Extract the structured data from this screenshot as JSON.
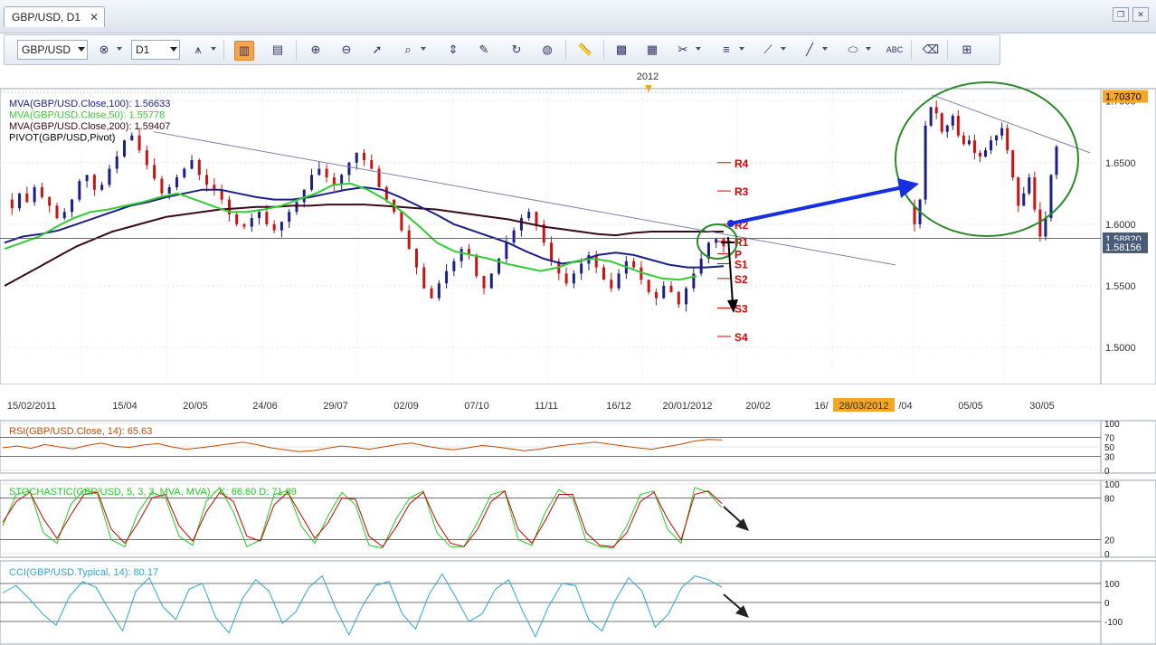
{
  "window": {
    "tab_title": "GBP/USD, D1",
    "close_glyph": "✕",
    "restore_glyph": "❐",
    "close_window_glyph": "✕"
  },
  "toolbar": {
    "symbol": "GBP/USD",
    "timeframe": "D1",
    "icons": [
      "add-remove-instrument-icon",
      "chart-type-icon",
      "bar-chart-icon",
      "candle-chart-icon",
      "period-separator-icon",
      "zoom-in-icon",
      "zoom-out-icon",
      "cursor-icon",
      "zoom-box-icon",
      "fit-icon",
      "export-icon",
      "reload-icon",
      "globe-icon",
      "ruler-icon",
      "picture-icon",
      "image-icon",
      "tools-icon",
      "indicators-icon",
      "drawing-icon",
      "line-icon",
      "ellipse-icon",
      "text-icon",
      "eraser-icon",
      "hierarchy-icon"
    ]
  },
  "chart_data": [
    {
      "type": "candlestick",
      "title": "",
      "top_label": "2012",
      "legend": [
        {
          "text": "MVA(GBP/USD.Close,100): 1.56633",
          "color": "#1b1f8a"
        },
        {
          "text": "MVA(GBP/USD.Close,50): 1.55778",
          "color": "#33cc33"
        },
        {
          "text": "MVA(GBP/USD.Close,200): 1.59407",
          "color": "#3a0a1a"
        },
        {
          "text": "PIVOT(GBP/USD,Pivot)",
          "color": "#000000"
        }
      ],
      "ylim": [
        1.47,
        1.71
      ],
      "y_ticks": [
        "1.7000",
        "1.6500",
        "1.6000",
        "1.5500",
        "1.5000"
      ],
      "price_labels": [
        {
          "value": 1.7037,
          "text": "1.70370",
          "bg": "#f5a623",
          "fg": "#000000"
        },
        {
          "value": 1.5882,
          "text": "1.58820",
          "bg": "#4a5b78",
          "fg": "#ffffff"
        },
        {
          "value": 1.5816,
          "text": "1.58156",
          "bg": "#4a5b78",
          "fg": "#ffffff"
        }
      ],
      "x_labels": [
        "15/02/2011",
        "15/04",
        "20/05",
        "24/06",
        "29/07",
        "02/09",
        "07/10",
        "11/11",
        "16/12",
        "20/01/2012",
        "20/02",
        "16/",
        "28/03/2012",
        "/04",
        "05/05",
        "30/05"
      ],
      "pivot_levels": [
        {
          "name": "R4",
          "value": 1.65,
          "color": "#dd0000"
        },
        {
          "name": "R3",
          "value": 1.627,
          "color": "#dd0000"
        },
        {
          "name": "R2",
          "value": 1.6,
          "color": "#dd0000"
        },
        {
          "name": "R1",
          "value": 1.586,
          "color": "#dd0000"
        },
        {
          "name": "P",
          "value": 1.576,
          "color": "#dd0000"
        },
        {
          "name": "S1",
          "value": 1.568,
          "color": "#dd0000"
        },
        {
          "name": "S2",
          "value": 1.556,
          "color": "#dd0000"
        },
        {
          "name": "S3",
          "value": 1.532,
          "color": "#dd0000"
        },
        {
          "name": "S4",
          "value": 1.509,
          "color": "#dd0000"
        }
      ],
      "price_path": [
        1.62,
        1.613,
        1.625,
        1.618,
        1.63,
        1.622,
        1.615,
        1.605,
        1.61,
        1.62,
        1.635,
        1.64,
        1.628,
        1.632,
        1.645,
        1.655,
        1.668,
        1.672,
        1.66,
        1.648,
        1.637,
        1.625,
        1.63,
        1.638,
        1.645,
        1.652,
        1.64,
        1.632,
        1.628,
        1.62,
        1.608,
        1.6,
        1.598,
        1.605,
        1.61,
        1.6,
        1.595,
        1.602,
        1.61,
        1.618,
        1.628,
        1.64,
        1.645,
        1.638,
        1.632,
        1.64,
        1.65,
        1.658,
        1.652,
        1.645,
        1.63,
        1.62,
        1.61,
        1.595,
        1.58,
        1.565,
        1.548,
        1.54,
        1.552,
        1.562,
        1.57,
        1.58,
        1.575,
        1.558,
        1.548,
        1.56,
        1.572,
        1.585,
        1.595,
        1.605,
        1.61,
        1.6,
        1.585,
        1.57,
        1.56,
        1.552,
        1.56,
        1.568,
        1.575,
        1.565,
        1.555,
        1.548,
        1.56,
        1.57,
        1.565,
        1.555,
        1.545,
        1.54,
        1.55,
        1.545,
        1.535,
        1.548,
        1.56,
        1.572,
        1.585,
        1.588,
        1.582
      ],
      "price_path2": [
        1.615,
        1.6,
        1.62,
        1.68,
        1.695,
        1.69,
        1.675,
        1.68,
        1.688,
        1.672,
        1.665,
        1.668,
        1.658,
        1.655,
        1.66,
        1.668,
        1.672,
        1.678,
        1.66,
        1.638,
        1.615,
        1.625,
        1.638,
        1.612,
        1.59,
        1.605,
        1.64,
        1.663
      ],
      "ma50": [
        1.58,
        1.585,
        1.59,
        1.598,
        1.605,
        1.61,
        1.612,
        1.615,
        1.618,
        1.622,
        1.625,
        1.62,
        1.615,
        1.61,
        1.61,
        1.612,
        1.615,
        1.62,
        1.625,
        1.632,
        1.633,
        1.628,
        1.62,
        1.61,
        1.598,
        1.585,
        1.578,
        1.575,
        1.572,
        1.568,
        1.565,
        1.562,
        1.565,
        1.57,
        1.572,
        1.57,
        1.565,
        1.56,
        1.556,
        1.555,
        1.558
      ],
      "ma100": [
        1.585,
        1.59,
        1.592,
        1.595,
        1.6,
        1.605,
        1.61,
        1.615,
        1.618,
        1.622,
        1.625,
        1.628,
        1.628,
        1.625,
        1.622,
        1.62,
        1.62,
        1.622,
        1.625,
        1.628,
        1.63,
        1.628,
        1.622,
        1.615,
        1.608,
        1.6,
        1.595,
        1.59,
        1.585,
        1.578,
        1.572,
        1.568,
        1.57,
        1.575,
        1.577,
        1.575,
        1.571,
        1.567,
        1.565,
        1.565,
        1.566
      ],
      "ma200": [
        1.55,
        1.558,
        1.566,
        1.574,
        1.582,
        1.588,
        1.594,
        1.598,
        1.602,
        1.606,
        1.608,
        1.61,
        1.612,
        1.613,
        1.614,
        1.614,
        1.615,
        1.615,
        1.616,
        1.616,
        1.616,
        1.615,
        1.614,
        1.613,
        1.612,
        1.61,
        1.608,
        1.606,
        1.604,
        1.601,
        1.598,
        1.596,
        1.594,
        1.592,
        1.591,
        1.593,
        1.594,
        1.594,
        1.594,
        1.594,
        1.594
      ]
    },
    {
      "type": "line",
      "title": "RSI(GBP/USD.Close, 14): 65.63",
      "series_color": "#c24a00",
      "ylim": [
        0,
        100
      ],
      "y_ticks": [
        "100",
        "70",
        "50",
        "30",
        "0"
      ],
      "values": [
        48,
        52,
        47,
        55,
        50,
        46,
        53,
        58,
        51,
        49,
        54,
        57,
        50,
        45,
        48,
        52,
        56,
        60,
        55,
        48,
        44,
        40,
        42,
        47,
        52,
        49,
        45,
        50,
        55,
        58,
        52,
        47,
        44,
        48,
        53,
        50,
        46,
        42,
        45,
        50,
        54,
        57,
        60,
        56,
        52,
        48,
        45,
        50,
        55,
        62,
        66,
        65
      ]
    },
    {
      "type": "line",
      "title": "STOCHASTIC(GBP/USD, 5, 3, 3, MVA, MVA) -  K: 66.60   D: 71.89",
      "k_color": "#22cc22",
      "d_color": "#cc0000",
      "ylim": [
        0,
        100
      ],
      "y_ticks": [
        "100",
        "80",
        "20",
        "0"
      ],
      "k_values": [
        40,
        85,
        90,
        30,
        15,
        70,
        92,
        85,
        20,
        10,
        60,
        88,
        80,
        25,
        12,
        75,
        95,
        60,
        10,
        20,
        85,
        90,
        40,
        15,
        55,
        88,
        70,
        12,
        8,
        50,
        80,
        90,
        30,
        10,
        10,
        45,
        85,
        90,
        20,
        12,
        60,
        92,
        80,
        18,
        10,
        8,
        40,
        85,
        90,
        35,
        15,
        95,
        88,
        66
      ],
      "d_values": [
        45,
        75,
        88,
        50,
        22,
        55,
        85,
        88,
        35,
        15,
        45,
        80,
        85,
        40,
        18,
        60,
        88,
        75,
        25,
        18,
        70,
        88,
        55,
        22,
        45,
        80,
        78,
        25,
        10,
        38,
        72,
        88,
        45,
        15,
        10,
        35,
        75,
        90,
        35,
        15,
        48,
        85,
        85,
        30,
        12,
        10,
        30,
        75,
        88,
        50,
        20,
        85,
        90,
        72
      ]
    },
    {
      "type": "line",
      "title": "CCI(GBP/USD.Typical, 14): 80.17",
      "series_color": "#2aa6d6",
      "ylim": [
        -200,
        200
      ],
      "y_ticks": [
        "100",
        "0",
        "-100"
      ],
      "values": [
        50,
        90,
        20,
        -60,
        -120,
        30,
        110,
        80,
        -40,
        -150,
        60,
        130,
        -20,
        -90,
        70,
        100,
        -80,
        -160,
        20,
        120,
        60,
        -110,
        -50,
        80,
        140,
        -30,
        -170,
        -20,
        90,
        110,
        -60,
        -140,
        40,
        150,
        30,
        -100,
        -60,
        70,
        120,
        -40,
        -180,
        -20,
        100,
        90,
        -90,
        -150,
        10,
        130,
        60,
        -130,
        -60,
        80,
        140,
        120,
        80
      ]
    }
  ]
}
